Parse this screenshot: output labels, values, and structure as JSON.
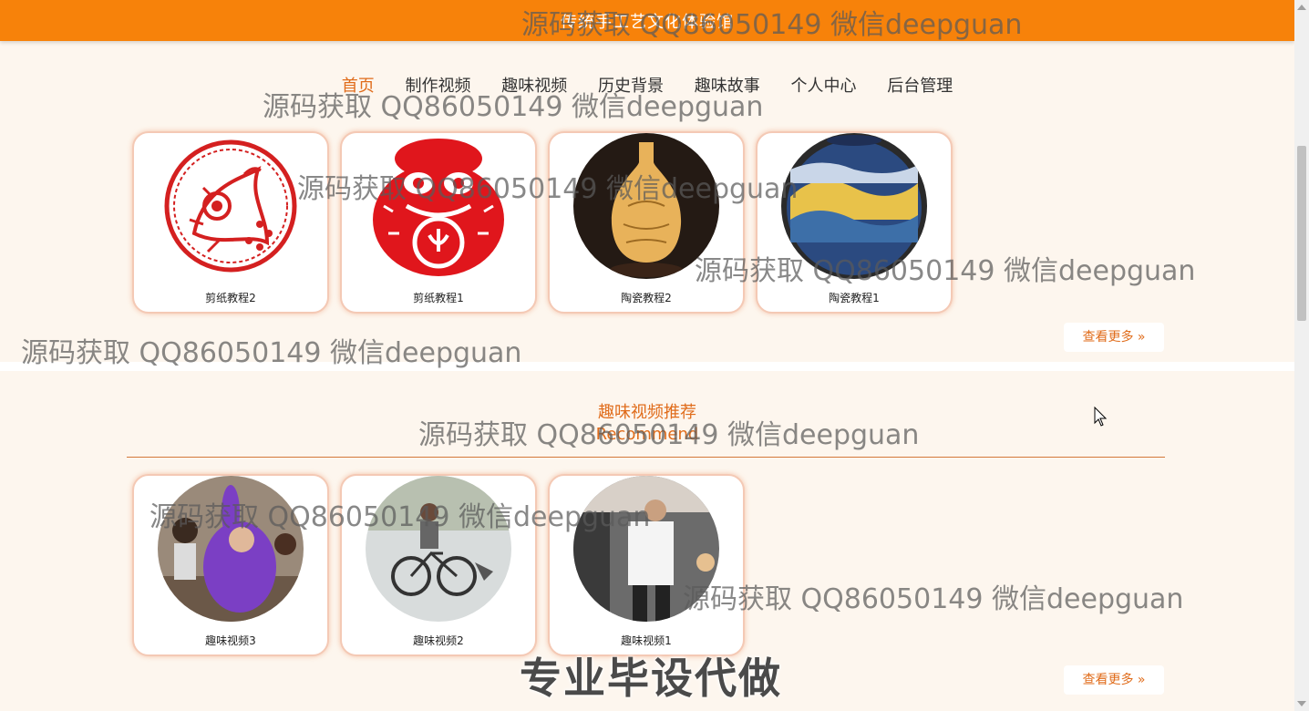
{
  "header": {
    "site_title": "传统手工艺文化体验馆",
    "bg_color": "#f7820a"
  },
  "nav": {
    "items": [
      {
        "label": "首页",
        "active": true
      },
      {
        "label": "制作视频"
      },
      {
        "label": "趣味视频"
      },
      {
        "label": "历史背景"
      },
      {
        "label": "趣味故事"
      },
      {
        "label": "个人中心"
      },
      {
        "label": "后台管理"
      }
    ],
    "active_color": "#e06c1b"
  },
  "tutorials": {
    "cards": [
      {
        "caption": "剪纸教程2",
        "image": "red-papercut-peacock"
      },
      {
        "caption": "剪纸教程1",
        "image": "red-papercut-monkey"
      },
      {
        "caption": "陶瓷教程2",
        "image": "lit-porcelain-vase"
      },
      {
        "caption": "陶瓷教程1",
        "image": "landscape-painted-jar"
      }
    ],
    "more_label": "查看更多"
  },
  "recommend": {
    "title": "趣味视频推荐",
    "subtitle": "Recommend",
    "cards": [
      {
        "caption": "趣味视频3",
        "image": "purple-costume-classroom"
      },
      {
        "caption": "趣味视频2",
        "image": "bicycle-rider"
      },
      {
        "caption": "趣味视频1",
        "image": "man-white-shirt"
      }
    ],
    "more_label": "查看更多"
  },
  "watermarks": [
    "源码获取 QQ86050149 微信deepguan",
    "源码获取 QQ86050149 微信deepguan",
    "源码获取 QQ86050149 微信deepguan",
    "源码获取 QQ86050149 微信deepguan",
    "源码获取 QQ86050149 微信deepguan",
    "源码获取 QQ86050149 微信deepguan",
    "源码获取 QQ86050149 微信deepguan",
    "源码获取 QQ86050149 微信deepguan"
  ],
  "banner": "专业毕设代做"
}
